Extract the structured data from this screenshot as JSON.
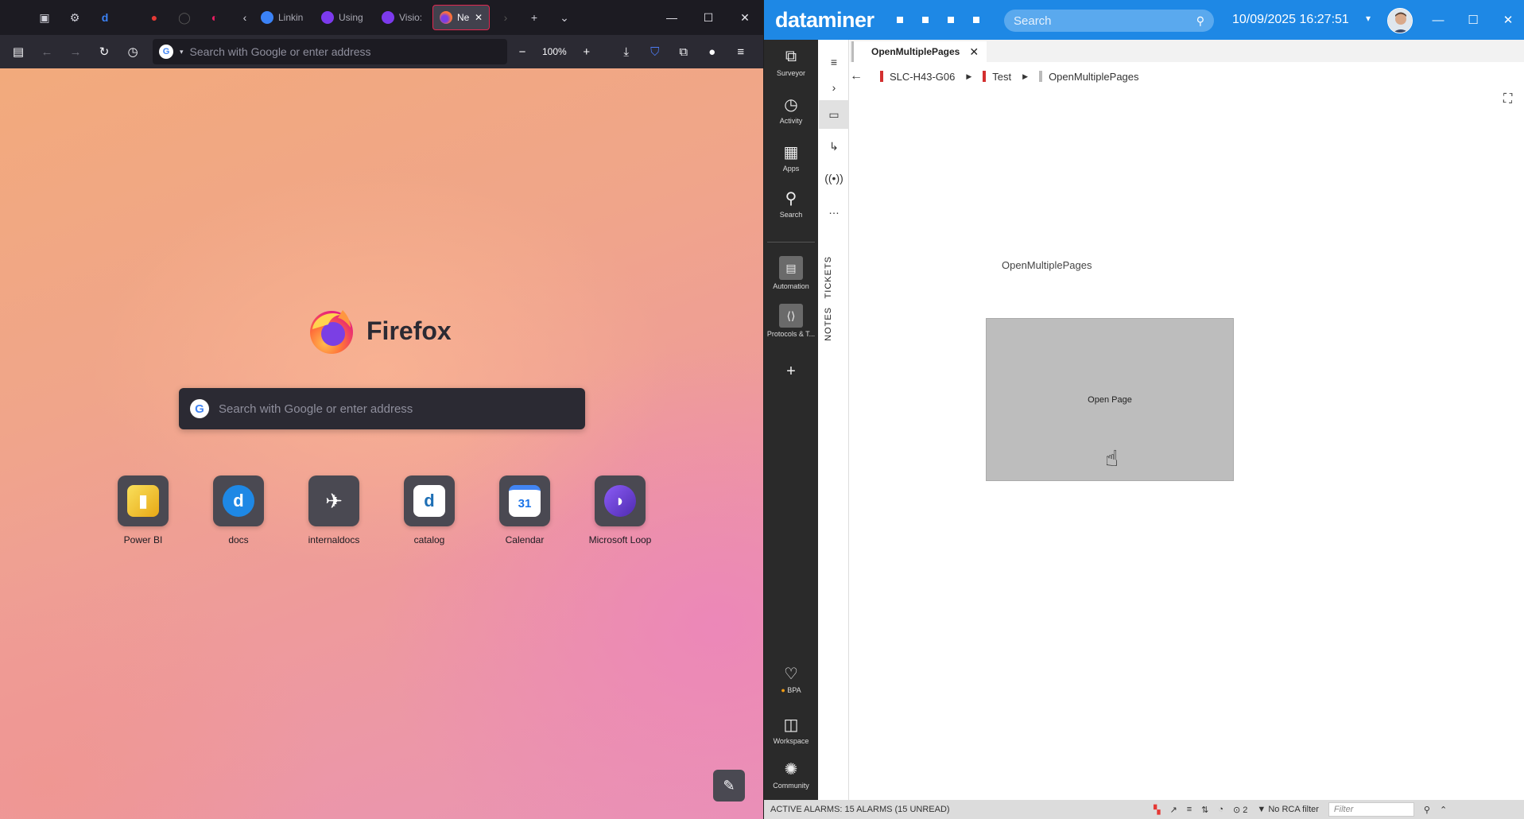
{
  "firefox": {
    "tabs": [
      {
        "label": "Linkin",
        "color": "#3b82f6"
      },
      {
        "label": "Using",
        "color": "#7c3aed"
      },
      {
        "label": "Visio:",
        "color": "#7c3aed"
      },
      {
        "label": "Ne",
        "color": "#f97316",
        "active": true
      }
    ],
    "url_placeholder": "Search with Google or enter address",
    "zoom": "100%",
    "brand": "Firefox",
    "search_placeholder": "Search with Google or enter address",
    "shortcuts": [
      {
        "label": "Power BI",
        "color": "#f2c811",
        "glyph": "▮"
      },
      {
        "label": "docs",
        "color": "#1e88e5",
        "glyph": "d"
      },
      {
        "label": "internaldocs",
        "color": "#3c6fc2",
        "glyph": "✈"
      },
      {
        "label": "catalog",
        "color": "#ffffff",
        "glyph": "d"
      },
      {
        "label": "Calendar",
        "color": "#ffffff",
        "glyph": "31"
      },
      {
        "label": "Microsoft Loop",
        "color": "#6b3fd4",
        "glyph": "◗"
      }
    ]
  },
  "dataminer": {
    "logo": "dataminer",
    "search_placeholder": "Search",
    "datetime": "10/09/2025 16:27:51",
    "rail": {
      "surveyor": "Surveyor",
      "activity": "Activity",
      "apps": "Apps",
      "search": "Search",
      "automation": "Automation",
      "protocols": "Protocols & T...",
      "bpa": "BPA",
      "workspace": "Workspace",
      "community": "Community"
    },
    "side": {
      "tickets": "TICKETS",
      "notes": "NOTES"
    },
    "tab": {
      "label": "OpenMultiplePages"
    },
    "breadcrumbs": [
      {
        "label": "SLC-H43-G06",
        "color": "#d32f2f"
      },
      {
        "label": "Test",
        "color": "#d32f2f"
      },
      {
        "label": "OpenMultiplePages",
        "color": "#bbbbbb"
      }
    ],
    "visual": {
      "title": "OpenMultiplePages",
      "button_label": "Open Page"
    },
    "status": {
      "alarms": "ACTIVE ALARMS: 15 ALARMS (15 UNREAD)",
      "count": "2",
      "rca": "No RCA filter",
      "filter_placeholder": "Filter"
    }
  }
}
